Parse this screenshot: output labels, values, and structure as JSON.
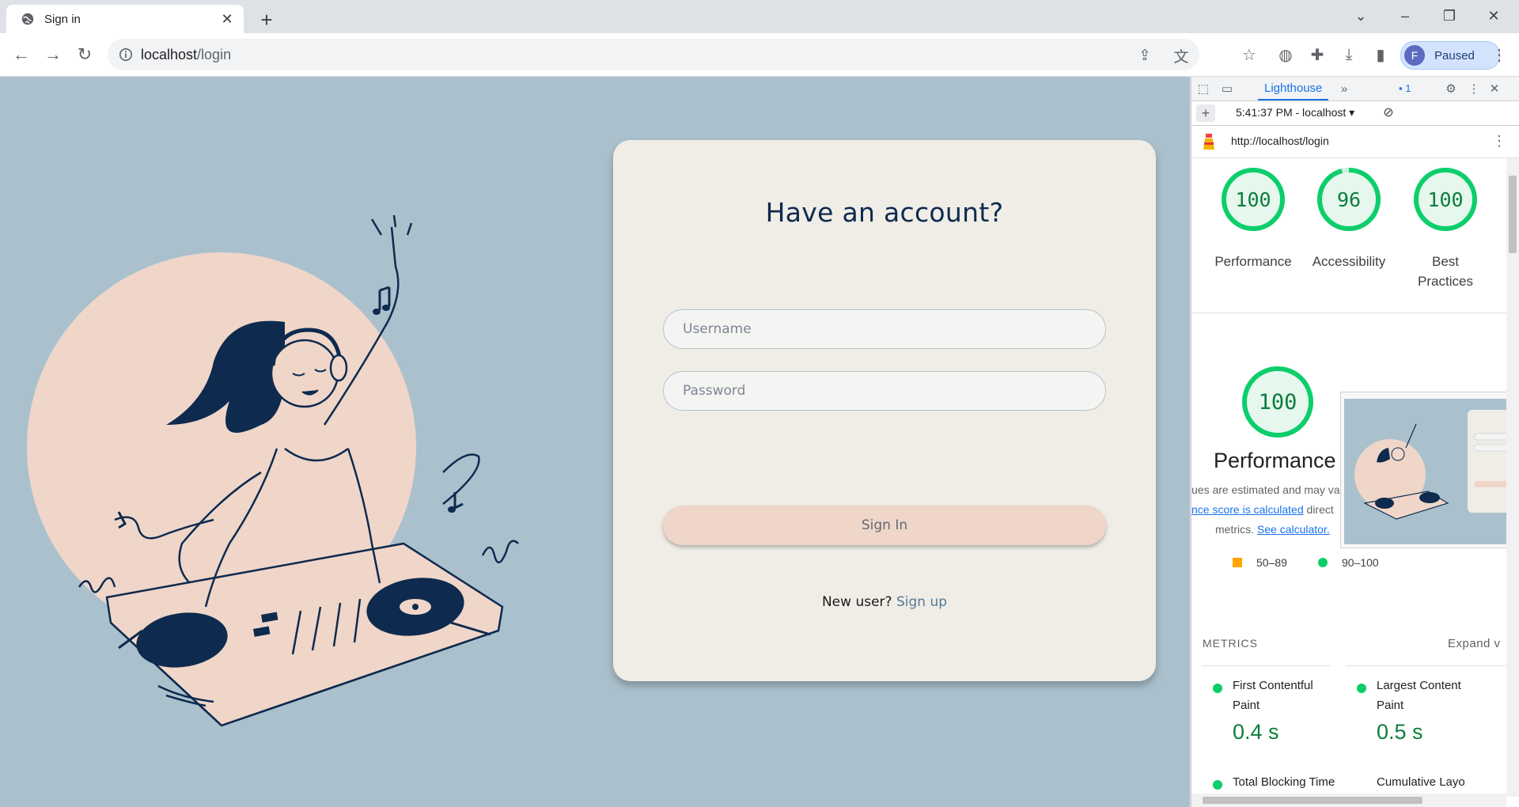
{
  "browser": {
    "tab_title": "Sign in",
    "url_host": "localhost",
    "url_path": "/login",
    "profile_initial": "F",
    "profile_status": "Paused"
  },
  "login": {
    "title": "Have an account?",
    "username_placeholder": "Username",
    "password_placeholder": "Password",
    "signin_label": "Sign In",
    "new_user_text": "New user?",
    "signup_link": "Sign up"
  },
  "devtools": {
    "active_tab": "Lighthouse",
    "issues_count": "1",
    "report_label": "5:41:37 PM - localhost",
    "report_url": "http://localhost/login",
    "scores": [
      {
        "value": "100",
        "label": "Performance",
        "fraction": 1.0
      },
      {
        "value": "96",
        "label": "Accessibility",
        "fraction": 0.96
      },
      {
        "value": "100",
        "label_line1": "Best",
        "label_line2": "Practices",
        "fraction": 1.0
      }
    ],
    "performance": {
      "score": "100",
      "title": "Performance",
      "desc_line1": "ues are estimated and may va",
      "desc_link1": "nce score is calculated",
      "desc_line2_tail": " direct",
      "desc_line3": "metrics. ",
      "desc_link2": "See calculator."
    },
    "legend": {
      "mid_range": "50–89",
      "high_range": "90–100"
    },
    "metrics_heading": "METRICS",
    "expand_label": "Expand v",
    "metrics": [
      {
        "label_line1": "First Contentful",
        "label_line2": "Paint",
        "value": "0.4 s"
      },
      {
        "label_line1": "Largest Content",
        "label_line2": "Paint",
        "value": "0.5 s"
      },
      {
        "label_line1": "Total Blocking Time",
        "label_line2": "",
        "value": ""
      },
      {
        "label_line1": "Cumulative Layo",
        "label_line2": "",
        "value": ""
      }
    ]
  },
  "colors": {
    "page_bg": "#aac1cd",
    "card_bg": "#efede6",
    "accent_peach": "#efd6c9",
    "navy": "#0e2a4e",
    "score_green": "#0cce6b"
  }
}
